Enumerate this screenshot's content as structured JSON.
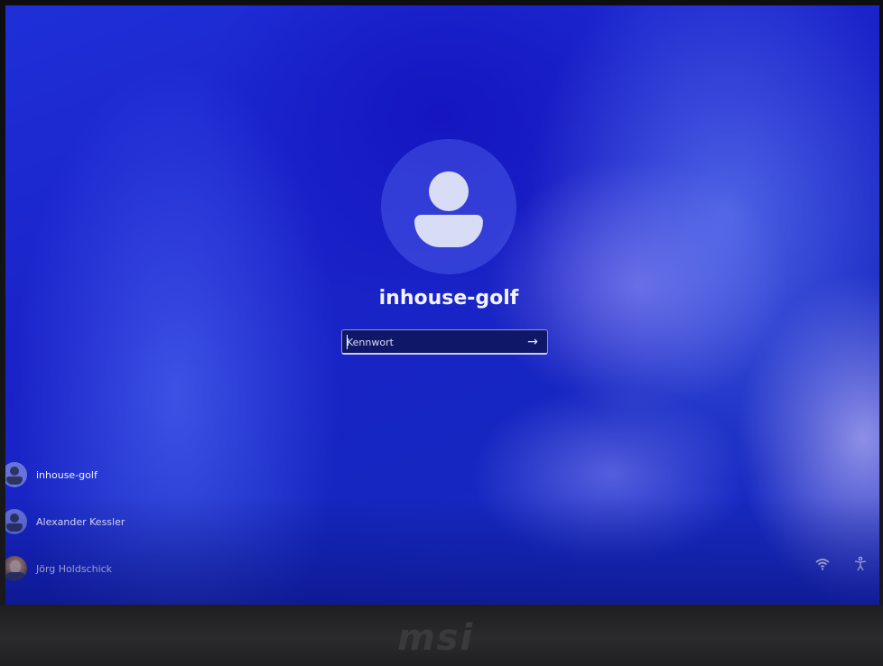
{
  "lock_screen": {
    "current_user": "inhouse-golf",
    "password_placeholder": "Kennwort",
    "submit_icon": "arrow-right-icon"
  },
  "user_list": [
    {
      "name": "inhouse-golf",
      "avatar": "default-user-icon"
    },
    {
      "name": "Alexander Kessler",
      "avatar": "default-user-icon"
    },
    {
      "name": "Jörg Holdschick",
      "avatar": "photo"
    }
  ],
  "tray": {
    "network_icon": "wifi-icon",
    "accessibility_icon": "accessibility-icon"
  },
  "bezel": {
    "brand": "msi"
  },
  "colors": {
    "wallpaper": "#1a26c8",
    "input_background": "#0f1868",
    "text": "#f2f3ff"
  }
}
